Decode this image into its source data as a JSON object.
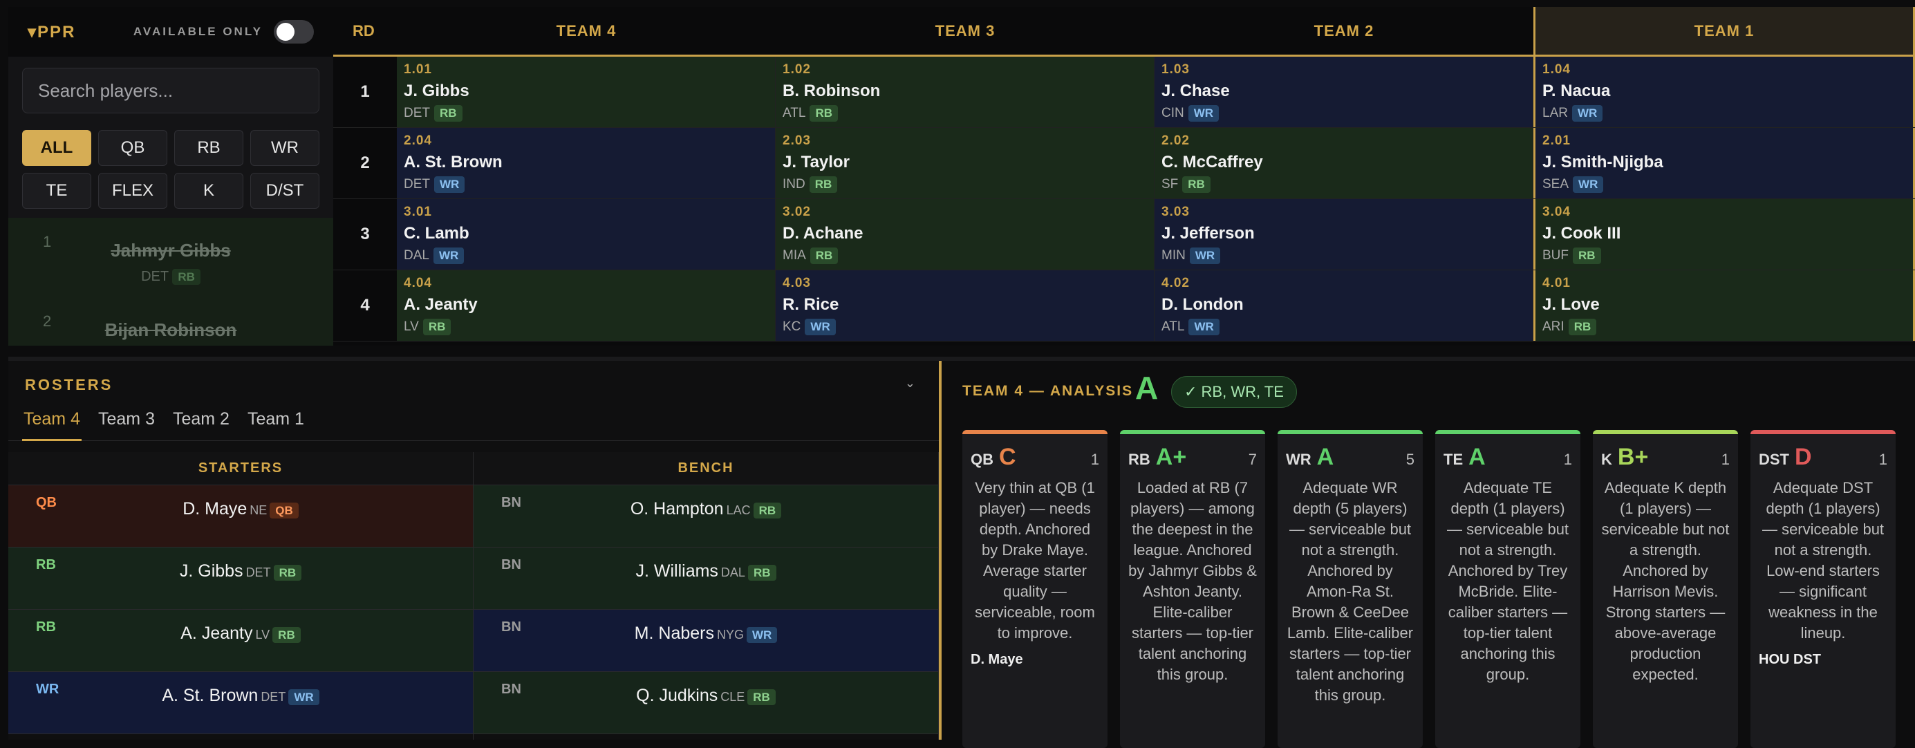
{
  "sidebar": {
    "scoring": "▾PPR",
    "available_label": "AVAILABLE ONLY",
    "search_placeholder": "Search players...",
    "positions": [
      "ALL",
      "QB",
      "RB",
      "WR",
      "TE",
      "FLEX",
      "K",
      "D/ST"
    ],
    "active_position": "ALL",
    "players": [
      {
        "rank": "1",
        "name": "Jahmyr Gibbs",
        "team": "DET",
        "pos": "RB"
      },
      {
        "rank": "2",
        "name": "Bijan Robinson",
        "team": "",
        "pos": ""
      }
    ]
  },
  "board": {
    "round_header": "RD",
    "teams": [
      "TEAM 4",
      "TEAM 3",
      "TEAM 2",
      "TEAM 1"
    ],
    "rounds": [
      {
        "rd": "1",
        "picks": [
          {
            "pick": "1.01",
            "name": "J. Gibbs",
            "team": "DET",
            "pos": "RB"
          },
          {
            "pick": "1.02",
            "name": "B. Robinson",
            "team": "ATL",
            "pos": "RB"
          },
          {
            "pick": "1.03",
            "name": "J. Chase",
            "team": "CIN",
            "pos": "WR"
          },
          {
            "pick": "1.04",
            "name": "P. Nacua",
            "team": "LAR",
            "pos": "WR"
          }
        ]
      },
      {
        "rd": "2",
        "picks": [
          {
            "pick": "2.04",
            "name": "A. St. Brown",
            "team": "DET",
            "pos": "WR"
          },
          {
            "pick": "2.03",
            "name": "J. Taylor",
            "team": "IND",
            "pos": "RB"
          },
          {
            "pick": "2.02",
            "name": "C. McCaffrey",
            "team": "SF",
            "pos": "RB"
          },
          {
            "pick": "2.01",
            "name": "J. Smith-Njigba",
            "team": "SEA",
            "pos": "WR"
          }
        ]
      },
      {
        "rd": "3",
        "picks": [
          {
            "pick": "3.01",
            "name": "C. Lamb",
            "team": "DAL",
            "pos": "WR"
          },
          {
            "pick": "3.02",
            "name": "D. Achane",
            "team": "MIA",
            "pos": "RB"
          },
          {
            "pick": "3.03",
            "name": "J. Jefferson",
            "team": "MIN",
            "pos": "WR"
          },
          {
            "pick": "3.04",
            "name": "J. Cook III",
            "team": "BUF",
            "pos": "RB"
          }
        ]
      },
      {
        "rd": "4",
        "picks": [
          {
            "pick": "4.04",
            "name": "A. Jeanty",
            "team": "LV",
            "pos": "RB"
          },
          {
            "pick": "4.03",
            "name": "R. Rice",
            "team": "KC",
            "pos": "WR"
          },
          {
            "pick": "4.02",
            "name": "D. London",
            "team": "ATL",
            "pos": "WR"
          },
          {
            "pick": "4.01",
            "name": "J. Love",
            "team": "ARI",
            "pos": "RB"
          }
        ]
      }
    ]
  },
  "rosters": {
    "title": "ROSTERS",
    "caret": "⌄",
    "tabs": [
      "Team 4",
      "Team 3",
      "Team 2",
      "Team 1"
    ],
    "active_tab": "Team 4",
    "starters_header": "STARTERS",
    "bench_header": "BENCH",
    "starters": [
      {
        "slot": "QB",
        "name": "D. Maye",
        "team": "NE",
        "pos": "QB"
      },
      {
        "slot": "RB",
        "name": "J. Gibbs",
        "team": "DET",
        "pos": "RB"
      },
      {
        "slot": "RB",
        "name": "A. Jeanty",
        "team": "LV",
        "pos": "RB"
      },
      {
        "slot": "WR",
        "name": "A. St. Brown",
        "team": "DET",
        "pos": "WR"
      }
    ],
    "bench": [
      {
        "slot": "BN",
        "name": "O. Hampton",
        "team": "LAC",
        "pos": "RB"
      },
      {
        "slot": "BN",
        "name": "J. Williams",
        "team": "DAL",
        "pos": "RB"
      },
      {
        "slot": "BN",
        "name": "M. Nabers",
        "team": "NYG",
        "pos": "WR"
      },
      {
        "slot": "BN",
        "name": "Q. Judkins",
        "team": "CLE",
        "pos": "RB"
      }
    ]
  },
  "analysis": {
    "title": "TEAM 4 — ANALYSIS",
    "grade": "A",
    "strengths": "✓ RB, WR, TE",
    "cards": [
      {
        "pos": "QB",
        "grade": "C",
        "count": "1",
        "color": "#e8844a",
        "desc": "Very thin at QB (1 player) — needs depth. Anchored by Drake Maye. Average starter quality — serviceable, room to improve.",
        "anchor": "D. Maye"
      },
      {
        "pos": "RB",
        "grade": "A+",
        "count": "7",
        "color": "#5fd16a",
        "desc": "Loaded at RB (7 players) — among the deepest in the league. Anchored by Jahmyr Gibbs & Ashton Jeanty. Elite-caliber starters — top-tier talent anchoring this group.",
        "anchor": ""
      },
      {
        "pos": "WR",
        "grade": "A",
        "count": "5",
        "color": "#5fd16a",
        "desc": "Adequate WR depth (5 players) — serviceable but not a strength. Anchored by Amon-Ra St. Brown & CeeDee Lamb. Elite-caliber starters — top-tier talent anchoring this group.",
        "anchor": ""
      },
      {
        "pos": "TE",
        "grade": "A",
        "count": "1",
        "color": "#5fd16a",
        "desc": "Adequate TE depth (1 players) — serviceable but not a strength. Anchored by Trey McBride. Elite-caliber starters — top-tier talent anchoring this group.",
        "anchor": ""
      },
      {
        "pos": "K",
        "grade": "B+",
        "count": "1",
        "color": "#a8d65a",
        "desc": "Adequate K depth (1 players) — serviceable but not a strength. Anchored by Harrison Mevis. Strong starters — above-average production expected.",
        "anchor": ""
      },
      {
        "pos": "DST",
        "grade": "D",
        "count": "1",
        "color": "#e05a5a",
        "desc": "Adequate DST depth (1 players) — serviceable but not a strength. Low-end starters — significant weakness in the lineup.",
        "anchor": "HOU DST"
      }
    ]
  }
}
